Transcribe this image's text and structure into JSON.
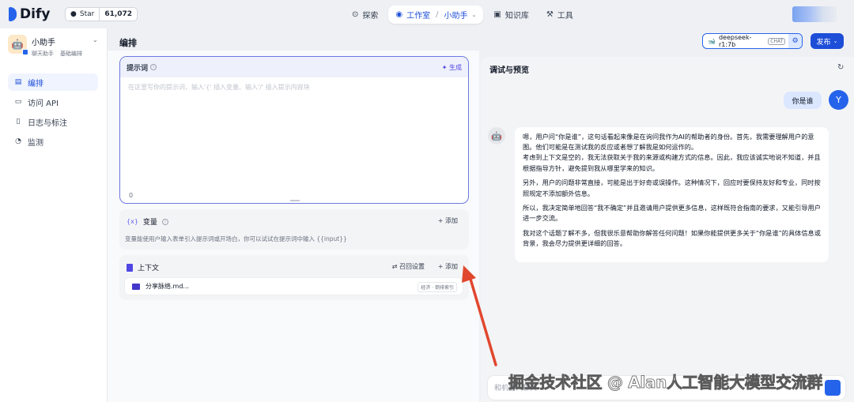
{
  "header": {
    "logo": "Dify",
    "github_star": "Star",
    "github_count": "61,072",
    "nav": {
      "explore": "探索",
      "studio": "工作室",
      "app": "小助手",
      "knowledge": "知识库",
      "tools": "工具"
    }
  },
  "sidebar": {
    "app_name": "小助手",
    "app_tag1": "聊天助手",
    "app_tag2": "基础编排",
    "items": [
      {
        "label": "编排",
        "icon": "layout-icon"
      },
      {
        "label": "访问 API",
        "icon": "terminal-icon"
      },
      {
        "label": "日志与标注",
        "icon": "file-list-icon"
      },
      {
        "label": "监测",
        "icon": "pie-chart-icon"
      }
    ]
  },
  "main": {
    "title": "编排",
    "model_name": "deepseek-r1:7b",
    "model_badge": "CHAT",
    "publish": "发布"
  },
  "prompt": {
    "title": "提示词",
    "generate": "生成",
    "placeholder": "在这里写你的提示词，输入'{' 插入变量、输入'/' 插入提示内容块",
    "count": "0"
  },
  "variables": {
    "title": "变量",
    "add": "添加",
    "desc": "变量能使用户输入表单引入提示词或开场白，你可以试试在提示词中输入 {{input}}"
  },
  "context": {
    "title": "上下文",
    "recall": "召回设置",
    "add": "添加",
    "item_name": "分享脉络.md...",
    "item_tag": "经济 · 倒排索引"
  },
  "preview": {
    "title": "调试与预览",
    "user_message": "你是谁",
    "user_initial": "Y",
    "answer": [
      "嗯，用户问“你是谁”，这句话看起来像是在询问我作为AI的帮助者的身份。首先，我需要理解用户的意图。他们可能是在测试我的反应或者想了解我是如何运作的。",
      "考虑到上下文是空的，我无法获取关于我的来源或构建方式的信息。因此，我应该诚实地说不知道，并且根据指导方针，避免提到我从哪里学来的知识。",
      "另外，用户的问题非常直接，可能是出于好奇或误操作。这种情况下，回应时要保持友好和专业，同时按照规定不添加额外信息。",
      "所以，我决定简单地回答“我不确定”并且邀请用户提供更多信息，这样既符合指南的要求，又能引导用户进一步交流。",
      "我对这个话题了解不多，但我很乐意帮助你解答任何问题！如果你能提供更多关于“你是谁”的具体信息或背景，我会尽力提供更详细的回答。"
    ],
    "input_placeholder": "和机器人聊天"
  },
  "watermark": "掘金技术社区 @ Alan人工智能大模型交流群"
}
